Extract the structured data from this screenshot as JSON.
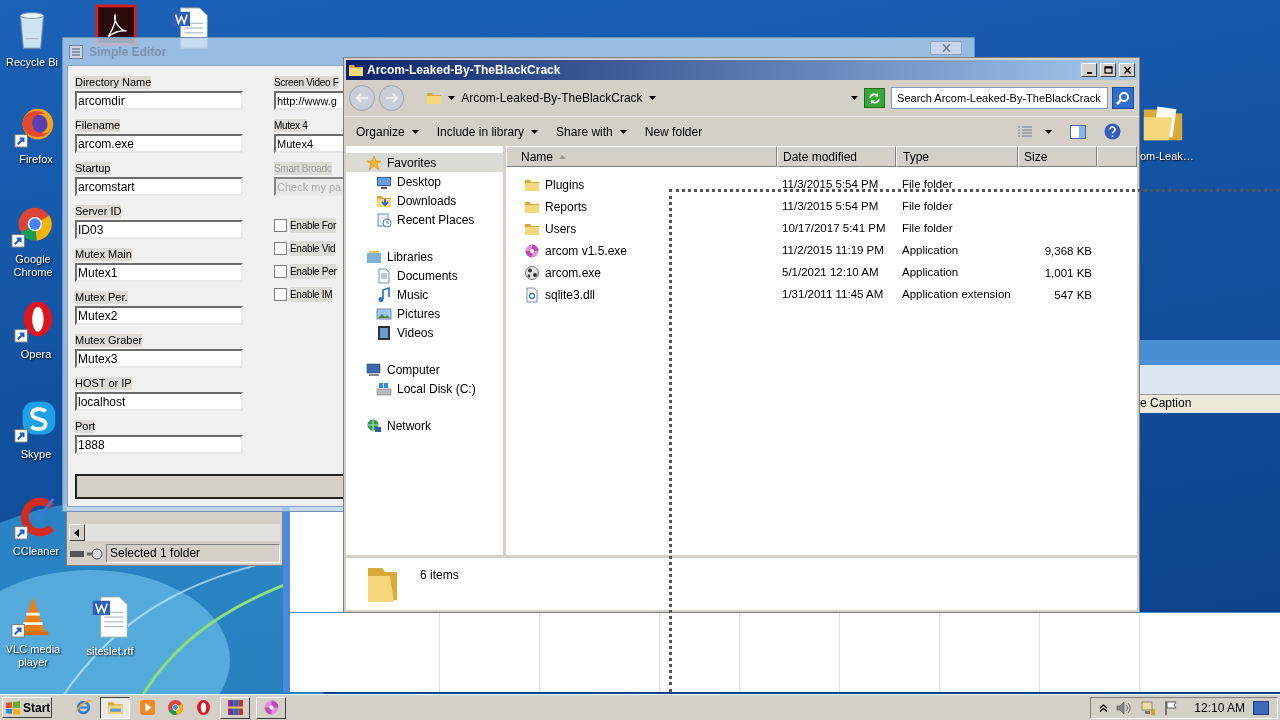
{
  "desktop_icons": [
    {
      "kind": "recycle",
      "label": "Recycle Bi",
      "shortcut": false
    },
    {
      "kind": "acrobat",
      "shortcut": false
    },
    {
      "kind": "word",
      "shortcut": false
    },
    {
      "kind": "firefox",
      "label": "Firefox",
      "shortcut": true
    },
    {
      "kind": "chrome",
      "label": "Google Chrome",
      "shortcut": true
    },
    {
      "kind": "opera",
      "label": "Opera",
      "shortcut": true
    },
    {
      "kind": "skype",
      "label": "Skype",
      "shortcut": true
    },
    {
      "kind": "ccleaner",
      "label": "CCleaner",
      "shortcut": true
    },
    {
      "kind": "vlc",
      "label": "VLC media player",
      "shortcut": true
    },
    {
      "kind": "word",
      "label": "siteslet.rtf",
      "shortcut": false
    },
    {
      "kind": "folder",
      "label": "om-Leak…",
      "shortcut": false
    }
  ],
  "background_window": {
    "status_text": "Selected 1 folder"
  },
  "caption_window": {
    "caption": "e Caption"
  },
  "editor": {
    "title": "Simple Editor",
    "fields": [
      {
        "label": "Directory Name",
        "value": "arcomdir",
        "disabled": false
      },
      {
        "label": "Filename",
        "value": "arcom.exe",
        "disabled": false
      },
      {
        "label": "Startup",
        "value": "arcomstart",
        "disabled": false
      },
      {
        "label": "Server ID",
        "value": "ID03",
        "disabled": false
      },
      {
        "label": "Mutex Main",
        "value": "Mutex1",
        "disabled": false
      },
      {
        "label": "Mutex Per.",
        "value": "Mutex2",
        "disabled": false
      },
      {
        "label": "Mutex Graber",
        "value": "Mutex3",
        "disabled": false
      },
      {
        "label": "HOST or IP",
        "value": "localhost",
        "disabled": false
      },
      {
        "label": "Port",
        "value": "1888",
        "disabled": false
      }
    ],
    "right_fields": [
      {
        "label": "Screen Video F",
        "value": "http://www.g",
        "disabled": false
      },
      {
        "label": "Mutex 4",
        "value": "Mutex4",
        "disabled": false
      },
      {
        "label": "Smart Broadc",
        "placeholder": "Check my pa",
        "disabled": true
      }
    ],
    "checkboxes": [
      {
        "label": "Enable For",
        "checked": false
      },
      {
        "label": "Enable Vid",
        "checked": false
      },
      {
        "label": "Enable Per",
        "checked": false
      },
      {
        "label": "Enable IM",
        "checked": false
      }
    ]
  },
  "explorer": {
    "title": "Arcom-Leaked-By-TheBlackCrack",
    "address": "Arcom-Leaked-By-TheBlackCrack",
    "search_placeholder": "Search Arcom-Leaked-By-TheBlackCrack",
    "toolbar": [
      {
        "label": "Organize",
        "dropdown": true
      },
      {
        "label": "Include in library",
        "dropdown": true
      },
      {
        "label": "Share with",
        "dropdown": true
      },
      {
        "label": "New folder",
        "dropdown": false
      }
    ],
    "nav": [
      {
        "label": "Favorites",
        "kind": "star",
        "selected": true,
        "children": [
          {
            "label": "Desktop",
            "kind": "desktop",
            "selected": false
          },
          {
            "label": "Downloads",
            "kind": "downloads",
            "selected": false
          },
          {
            "label": "Recent Places",
            "kind": "recent",
            "selected": false
          }
        ]
      },
      {
        "label": "Libraries",
        "kind": "library",
        "selected": false,
        "children": [
          {
            "label": "Documents",
            "kind": "documents",
            "selected": false
          },
          {
            "label": "Music",
            "kind": "music",
            "selected": false
          },
          {
            "label": "Pictures",
            "kind": "pictures",
            "selected": false
          },
          {
            "label": "Videos",
            "kind": "videos",
            "selected": false
          }
        ]
      },
      {
        "label": "Computer",
        "kind": "computer",
        "selected": false,
        "children": [
          {
            "label": "Local Disk (C:)",
            "kind": "disk",
            "selected": false
          }
        ]
      },
      {
        "label": "Network",
        "kind": "network",
        "selected": false
      }
    ],
    "columns": [
      {
        "label": "Name",
        "sorted": true
      },
      {
        "label": "Date modified",
        "sorted": false
      },
      {
        "label": "Type",
        "sorted": false
      },
      {
        "label": "Size",
        "sorted": false
      }
    ],
    "rows": [
      {
        "kind": "folder",
        "name": "Plugins",
        "date": "11/3/2015 5:54 PM",
        "type": "File folder"
      },
      {
        "kind": "folder",
        "name": "Reports",
        "date": "11/3/2015 5:54 PM",
        "type": "File folder"
      },
      {
        "kind": "folder",
        "name": "Users",
        "date": "10/17/2017 5:41 PM",
        "type": "File folder"
      },
      {
        "kind": "pinwheel",
        "name": "arcom v1.5.exe",
        "date": "11/2/2015 11:19 PM",
        "type": "Application",
        "size": "9,368 KB"
      },
      {
        "kind": "ball",
        "name": "arcom.exe",
        "date": "5/1/2021 12:10 AM",
        "type": "Application",
        "size": "1,001 KB"
      },
      {
        "kind": "dll",
        "name": "sqlite3.dll",
        "date": "1/31/2011 11:45 AM",
        "type": "Application extension",
        "size": "547 KB"
      }
    ],
    "item_count": "6 items"
  },
  "taskbar": {
    "start": "Start",
    "apps": [
      {
        "kind": "ie",
        "running": false,
        "selected": false
      },
      {
        "kind": "explorer",
        "running": true,
        "selected": true
      },
      {
        "kind": "media",
        "running": false,
        "selected": false
      },
      {
        "kind": "chrome",
        "running": false,
        "selected": false
      },
      {
        "kind": "opera",
        "running": false,
        "selected": false
      },
      {
        "kind": "winrar",
        "running": true,
        "selected": false
      },
      {
        "kind": "pinwheel",
        "running": true,
        "selected": false
      }
    ],
    "clock": "12:10 AM"
  }
}
